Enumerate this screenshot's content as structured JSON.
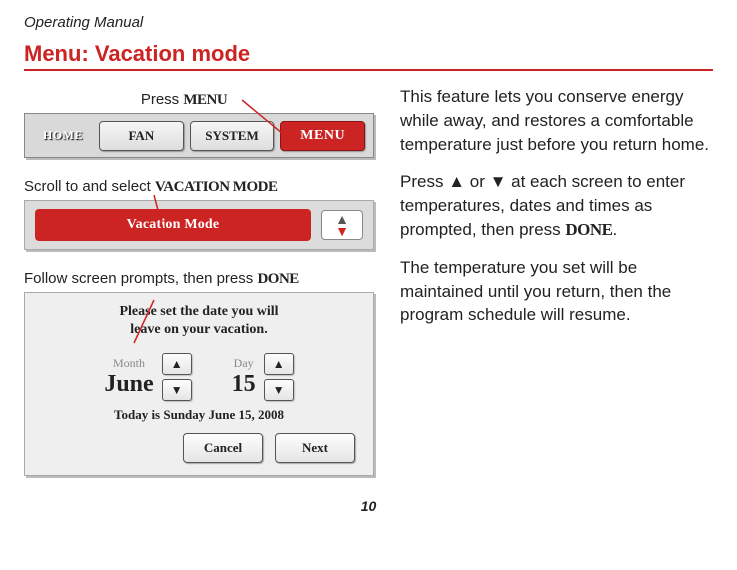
{
  "header": "Operating Manual",
  "title": "Menu: Vacation mode",
  "press_menu_label": "Press ",
  "press_menu_word": "MENU",
  "bar1": {
    "home": "HOME",
    "fan": "FAN",
    "system": "SYSTEM",
    "menu": "MENU"
  },
  "scroll_label_pre": "Scroll to and select ",
  "scroll_label_word": "VACATION MODE",
  "vacation_pill": "Vacation Mode",
  "follow_label_pre": "Follow screen prompts, then press ",
  "follow_label_word": "DONE",
  "screen": {
    "line1": "Please set the date you will",
    "line2": "leave on your vacation.",
    "month_label": "Month",
    "month_value": "June",
    "day_label": "Day",
    "day_value": "15",
    "today": "Today is Sunday June 15, 2008",
    "cancel": "Cancel",
    "next": "Next"
  },
  "right": {
    "p1": "This feature lets you conserve energy while away, and restores a comfortable temperature just before you return home.",
    "p2a": "Press ",
    "p2b": " or ",
    "p2c": " at each screen to enter temperatures, dates and times as prompted, then press ",
    "p2_done": "DONE",
    "p2d": ".",
    "p3": "The temperature you set will be maintained until you return, then the program schedule will resume."
  },
  "page_number": "10"
}
